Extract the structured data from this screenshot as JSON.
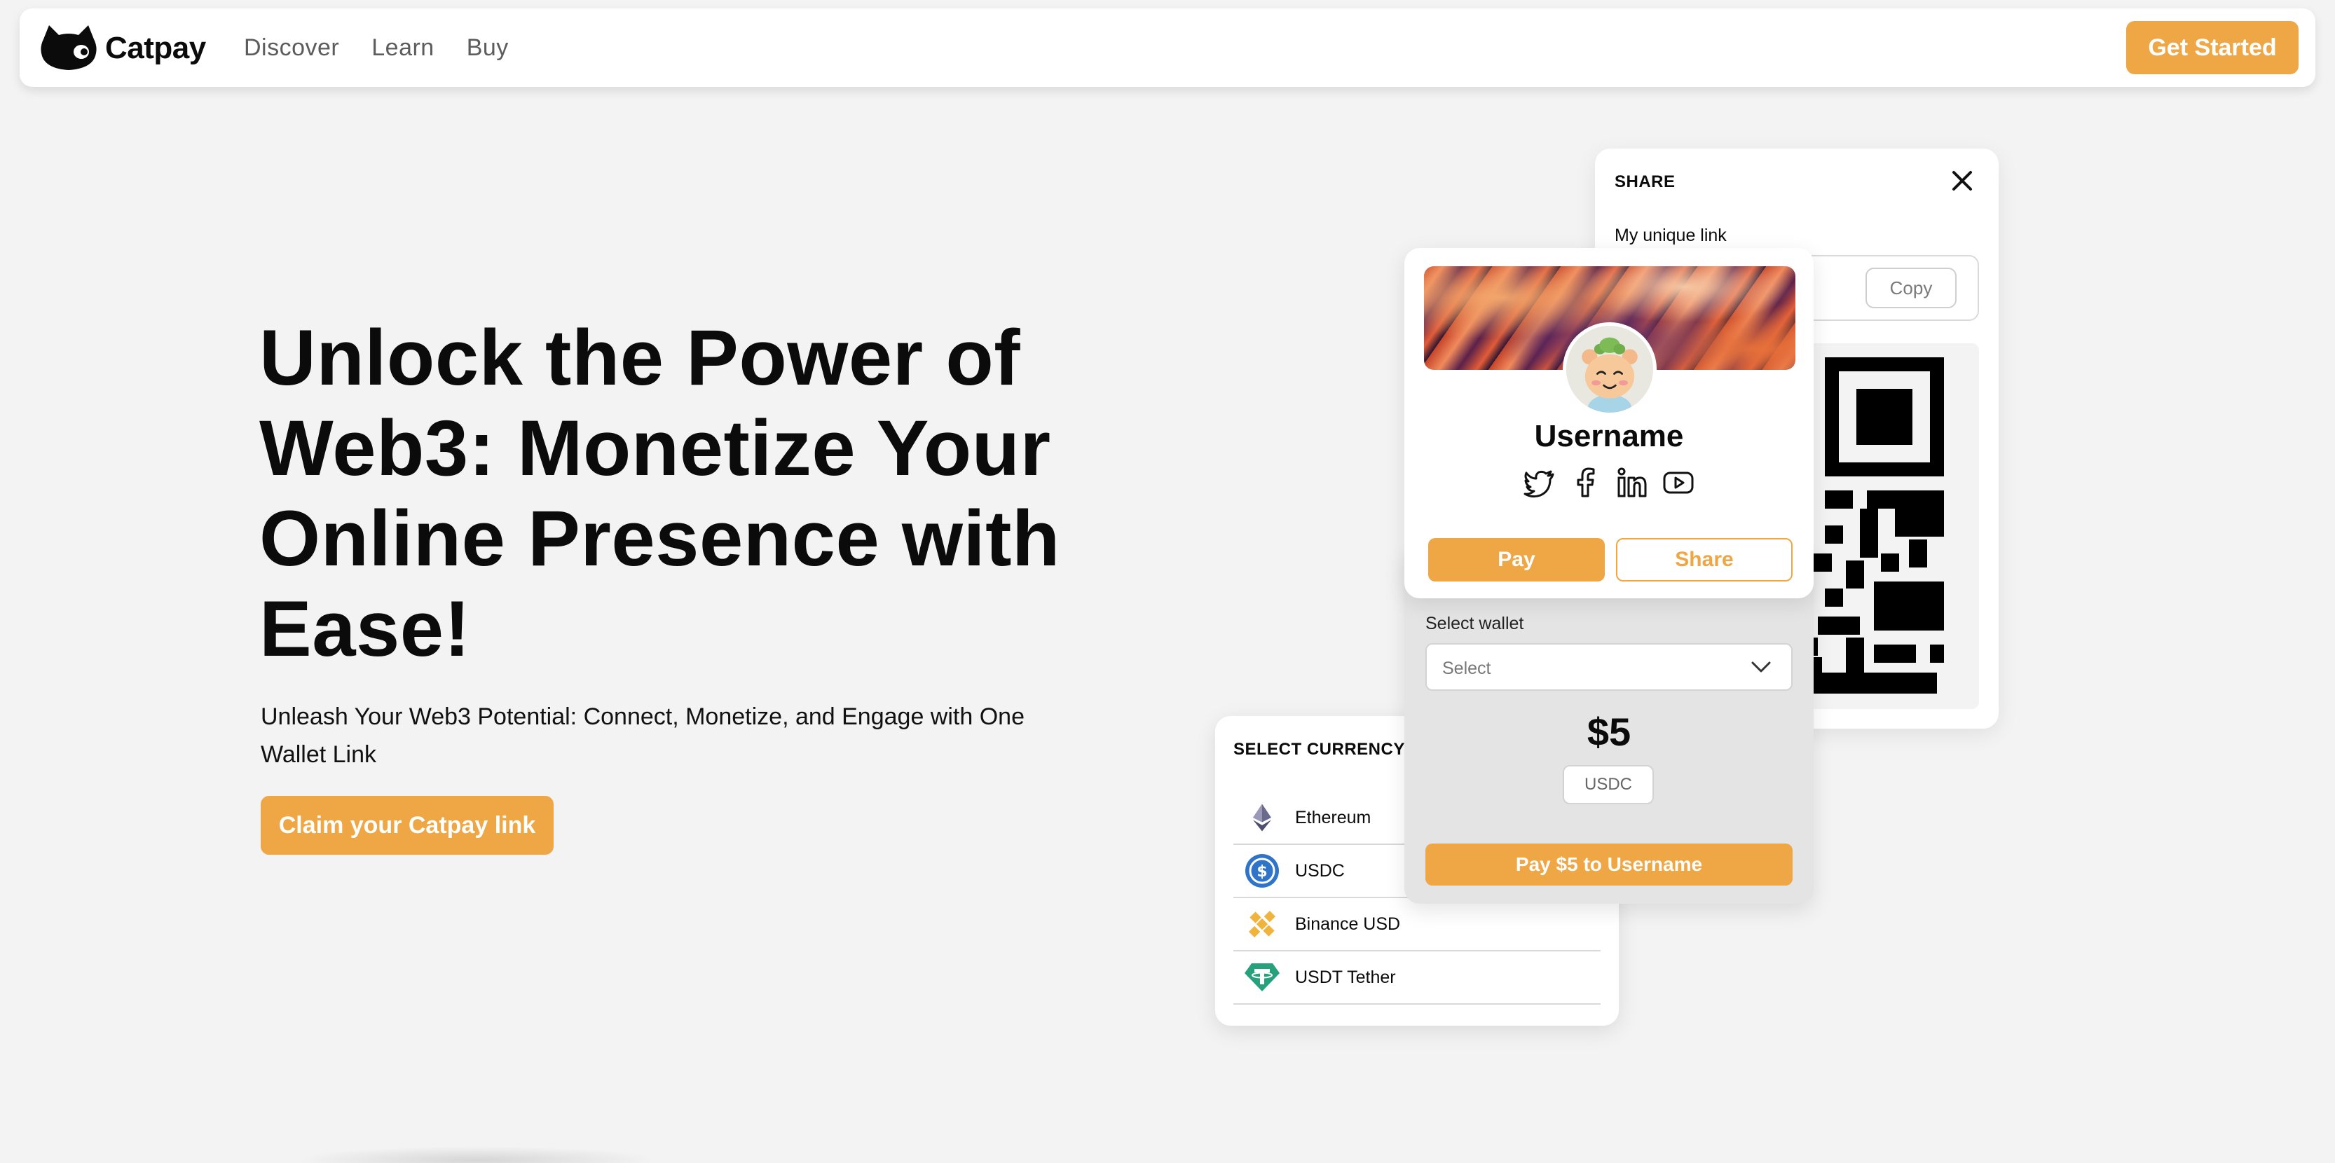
{
  "nav": {
    "brand": "Catpay",
    "links": [
      "Discover",
      "Learn",
      "Buy"
    ],
    "cta": "Get Started"
  },
  "hero": {
    "title": "Unlock the Power of Web3: Monetize Your Online Presence with Ease!",
    "subtitle": "Unleash Your Web3 Potential: Connect, Monetize, and Engage with One Wallet Link",
    "cta": "Claim your Catpay link"
  },
  "share": {
    "title": "SHARE",
    "link_label": "My unique link",
    "copy_label": "Copy"
  },
  "profile": {
    "username": "Username",
    "socials": [
      "twitter-icon",
      "facebook-icon",
      "linkedin-icon",
      "youtube-icon"
    ],
    "pay_label": "Pay",
    "share_label": "Share"
  },
  "payment": {
    "wallet_label": "Select wallet",
    "wallet_placeholder": "Select",
    "amount": "$5",
    "currency": "USDC",
    "pay_button": "Pay $5 to Username"
  },
  "currency": {
    "title": "SELECT CURRENCY",
    "items": [
      {
        "label": "Ethereum",
        "icon": "ethereum-icon"
      },
      {
        "label": "USDC",
        "icon": "usdc-icon"
      },
      {
        "label": "Binance USD",
        "icon": "binance-usd-icon"
      },
      {
        "label": "USDT Tether",
        "icon": "tether-icon"
      }
    ]
  },
  "colors": {
    "accent": "#efa746",
    "background": "#f3f3f3"
  }
}
